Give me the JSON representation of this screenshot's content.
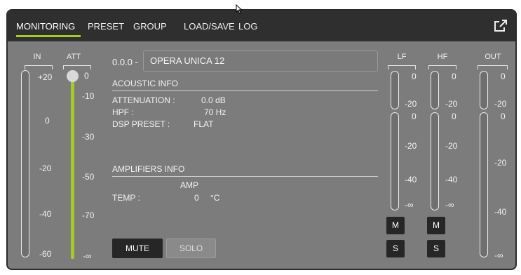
{
  "tabs": [
    {
      "label": "MONITORING",
      "active": true
    },
    {
      "label": "PRESET"
    },
    {
      "label": "GROUP"
    },
    {
      "label": "LOAD/SAVE"
    },
    {
      "label": "LOG"
    }
  ],
  "device": {
    "address": "0.0.0 -",
    "name": "OPERA UNICA 12"
  },
  "in_meter": {
    "label": "IN",
    "ticks": [
      "+20",
      "0",
      "-20",
      "-40",
      "-60"
    ]
  },
  "att": {
    "label": "ATT",
    "ticks": [
      "0",
      "-10",
      "-30",
      "-50",
      "-70",
      "-∞"
    ],
    "level": 0
  },
  "acoustic": {
    "title": "ACOUSTIC INFO",
    "attenuation_label": "ATTENUATION :",
    "attenuation_value": "0.0 dB",
    "hpf_label": "HPF :",
    "hpf_value": "70 Hz",
    "dsp_label": "DSP PRESET :",
    "dsp_value": "FLAT"
  },
  "amplifiers": {
    "title": "AMPLIFIERS INFO",
    "col_header": "AMP",
    "temp_label": "TEMP :",
    "temp_value": "0",
    "temp_unit": "°C"
  },
  "buttons": {
    "mute": "MUTE",
    "solo": "SOLO"
  },
  "lf": {
    "label": "LF",
    "upper_ticks": [
      "0",
      "-20"
    ],
    "lower_ticks": [
      "0",
      "-20",
      "-40",
      "-∞"
    ],
    "mute": "M",
    "solo": "S"
  },
  "hf": {
    "label": "HF",
    "upper_ticks": [
      "0",
      "-20"
    ],
    "lower_ticks": [
      "0",
      "-20",
      "-40",
      "-∞"
    ],
    "mute": "M",
    "solo": "S"
  },
  "out_meter": {
    "label": "OUT",
    "upper_ticks": [
      "0",
      "-20"
    ],
    "lower_ticks": [
      "0",
      "-20",
      "-40",
      "-∞"
    ]
  },
  "colors": {
    "accent": "#a6cc1f",
    "panel": "#7c7c7c",
    "topbar": "#2f2f2f"
  },
  "icons": {
    "expand": "expand-icon"
  }
}
